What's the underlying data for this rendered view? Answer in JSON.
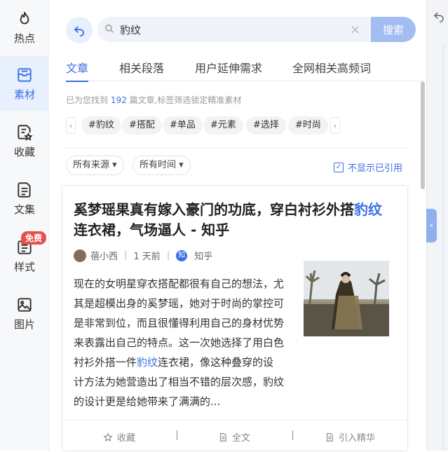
{
  "sidebar": {
    "items": [
      {
        "label": "热点",
        "icon": "flame-icon"
      },
      {
        "label": "素材",
        "icon": "inbox-icon"
      },
      {
        "label": "收藏",
        "icon": "star-doc-icon"
      },
      {
        "label": "文集",
        "icon": "document-icon"
      },
      {
        "label": "样式",
        "icon": "style-icon"
      },
      {
        "label": "图片",
        "icon": "image-icon"
      }
    ],
    "badge": "免费"
  },
  "search": {
    "value": "豹纹",
    "placeholder": "",
    "button_label": "搜索",
    "clear": "×"
  },
  "tabs": [
    "文章",
    "相关段落",
    "用户延伸需求",
    "全网相关高频词"
  ],
  "result_info": {
    "prefix": "已为您找到",
    "count": "192",
    "suffix": "篇文章,标签筛选锁定精准素材"
  },
  "tags": [
    "#豹纹",
    "#搭配",
    "#单品",
    "#元素",
    "#选择",
    "#时尚"
  ],
  "tag_nav": {
    "prev": "‹",
    "next": "›"
  },
  "filters": {
    "source": "所有来源",
    "time": "所有时间",
    "no_cited": "不显示已引用"
  },
  "article": {
    "title_part1": "奚梦瑶果真有嫁入豪门的功底，穿白衬衫外搭",
    "title_highlight": "豹纹",
    "title_part2": "连衣裙，气场逼人 - 知乎",
    "author": "蓓小西",
    "time": "1 天前",
    "source_icon": "知",
    "source": "知乎",
    "summary_part1": "现在的女明星穿衣搭配都很有自己的想法，尤其是超模出身的奚梦瑶，她对于时尚的掌控可是非常到位，而且很懂得利用自己的身材优势来表露出自己的特点。这一次她选择了用白色衬衫外搭一件",
    "summary_highlight": "豹纹",
    "summary_part2": "连衣裙，像这种叠穿的设计方法为她营造出了相当不错的层次感，豹纹的设计更是给她带来了满满的...",
    "actions": {
      "favorite": "收藏",
      "fulltext": "全文",
      "quote": "引入精华"
    }
  },
  "colors": {
    "accent": "#3b6ee6",
    "badge": "#e84e4e",
    "search_button": "#a3bdf2"
  }
}
